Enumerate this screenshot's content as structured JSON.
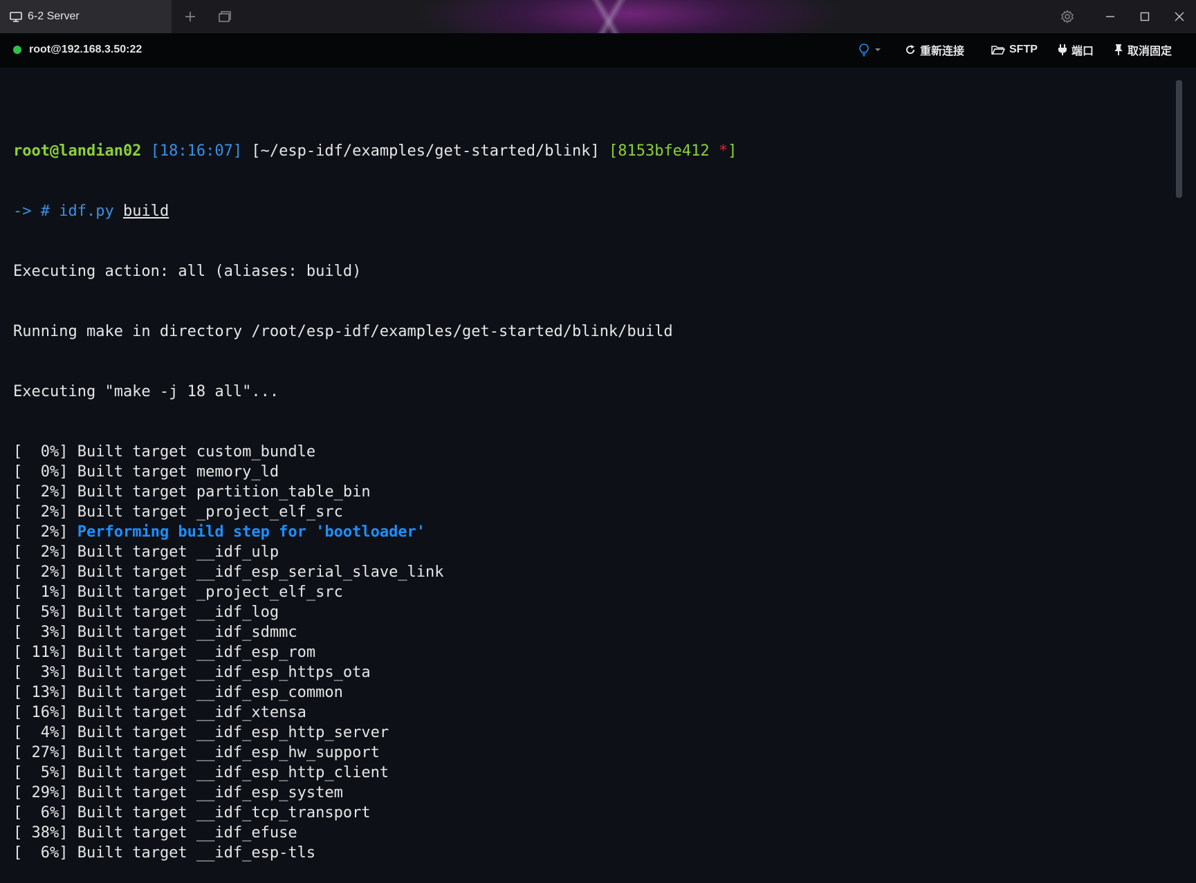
{
  "window": {
    "tab_title": "6-2 Server"
  },
  "toolbar": {
    "connection": "root@192.168.3.50:22",
    "connection_status_color": "#2ec24a",
    "reconnect": "重新连接",
    "sftp": "SFTP",
    "ports": "端口",
    "unpin": "取消固定"
  },
  "terminal": {
    "prompt": {
      "user": "root@landian02",
      "time": "[18:16:07]",
      "path": "[~/esp-idf/examples/get-started/blink]",
      "git_open": "[8153bfe412",
      "git_dirty": "*",
      "git_close": "]",
      "arrow": "-> #",
      "command": "idf.py",
      "argument": "build"
    },
    "lines": [
      "Executing action: all (aliases: build)",
      "Running make in directory /root/esp-idf/examples/get-started/blink/build",
      "Executing \"make -j 18 all\"..."
    ],
    "build_lines": [
      {
        "pct": "[  0%]",
        "text": "Built target custom_bundle"
      },
      {
        "pct": "[  0%]",
        "text": "Built target memory_ld"
      },
      {
        "pct": "[  2%]",
        "text": "Built target partition_table_bin"
      },
      {
        "pct": "[  2%]",
        "text": "Built target _project_elf_src"
      },
      {
        "pct": "[  2%]",
        "text": "Performing build step for 'bootloader'",
        "highlight": true
      },
      {
        "pct": "[  2%]",
        "text": "Built target __idf_ulp"
      },
      {
        "pct": "[  2%]",
        "text": "Built target __idf_esp_serial_slave_link"
      },
      {
        "pct": "[  1%]",
        "text": "Built target _project_elf_src"
      },
      {
        "pct": "[  5%]",
        "text": "Built target __idf_log"
      },
      {
        "pct": "[  3%]",
        "text": "Built target __idf_sdmmc"
      },
      {
        "pct": "[ 11%]",
        "text": "Built target __idf_esp_rom"
      },
      {
        "pct": "[  3%]",
        "text": "Built target __idf_esp_https_ota"
      },
      {
        "pct": "[ 13%]",
        "text": "Built target __idf_esp_common"
      },
      {
        "pct": "[ 16%]",
        "text": "Built target __idf_xtensa"
      },
      {
        "pct": "[  4%]",
        "text": "Built target __idf_esp_http_server"
      },
      {
        "pct": "[ 27%]",
        "text": "Built target __idf_esp_hw_support"
      },
      {
        "pct": "[  5%]",
        "text": "Built target __idf_esp_http_client"
      },
      {
        "pct": "[ 29%]",
        "text": "Built target __idf_esp_system"
      },
      {
        "pct": "[  6%]",
        "text": "Built target __idf_tcp_transport"
      },
      {
        "pct": "[ 38%]",
        "text": "Built target __idf_efuse"
      },
      {
        "pct": "[  6%]",
        "text": "Built target __idf_esp-tls"
      }
    ]
  }
}
